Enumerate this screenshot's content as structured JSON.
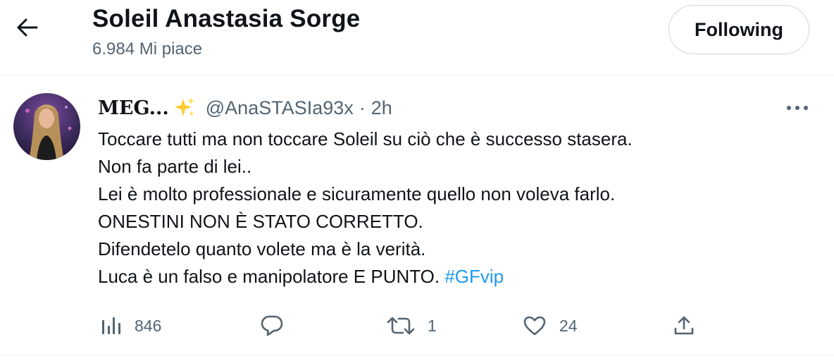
{
  "header": {
    "title": "Soleil Anastasia Sorge",
    "subtitle": "6.984 Mi piace",
    "follow_label": "Following"
  },
  "tweet": {
    "display_name": "MEG...",
    "handle": "@AnaSTASIa93x",
    "separator": "·",
    "time": "2h",
    "lines": [
      "Toccare tutti ma non toccare Soleil su ciò che è successo stasera.",
      "Non fa parte di lei..",
      "Lei è molto professionale e sicuramente quello non voleva farlo.",
      "ONESTINI NON È STATO CORRETTO.",
      "Difendetelo quanto volete ma è la verità.",
      "Luca è un falso e manipolatore E PUNTO. "
    ],
    "hashtag": "#GFvip",
    "stats": {
      "views": "846",
      "replies": "",
      "retweets": "1",
      "likes": "24"
    }
  },
  "icons": {
    "back": "arrow-left-icon",
    "sparkle": "sparkles-emoji",
    "more": "more-dots-icon",
    "views": "bar-chart-icon",
    "reply": "speech-bubble-icon",
    "retweet": "retweet-icon",
    "like": "heart-icon",
    "share": "share-upload-icon"
  },
  "colors": {
    "text": "#0f1419",
    "secondary": "#536471",
    "hashtag": "#1d9bf0",
    "border": "#eff3f4"
  }
}
